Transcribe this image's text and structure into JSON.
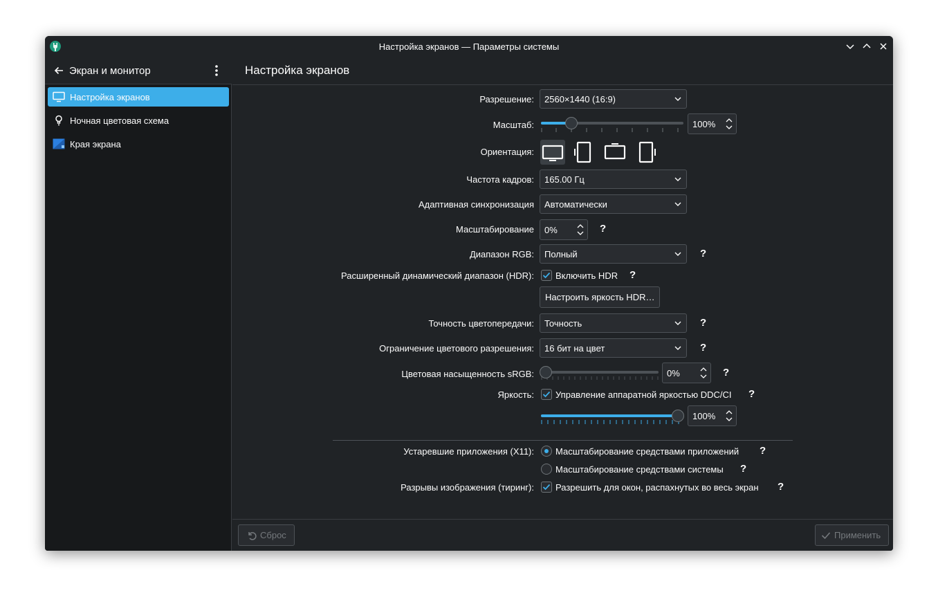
{
  "window": {
    "title": "Настройка экранов — Параметры системы"
  },
  "sidebar": {
    "header": "Экран и монитор",
    "items": [
      {
        "label": "Настройка экранов",
        "icon": "monitor-icon",
        "active": true
      },
      {
        "label": "Ночная цветовая схема",
        "icon": "bulb-icon",
        "active": false
      },
      {
        "label": "Края экрана",
        "icon": "screen-edges-icon",
        "active": false
      }
    ]
  },
  "page": {
    "title": "Настройка экранов"
  },
  "form": {
    "resolution": {
      "label": "Разрешение:",
      "value": "2560×1440 (16:9)"
    },
    "scale": {
      "label": "Масштаб:",
      "value": "100%",
      "slider_fraction": 0.2
    },
    "orientation": {
      "label": "Ориентация:"
    },
    "refresh": {
      "label": "Частота кадров:",
      "value": "165.00 Гц"
    },
    "adaptive_sync": {
      "label": "Адаптивная синхронизация",
      "value": "Автоматически"
    },
    "overscan": {
      "label": "Масштабирование",
      "value": "0%"
    },
    "rgb_range": {
      "label": "Диапазон RGB:",
      "value": "Полный"
    },
    "hdr": {
      "label": "Расширенный динамический диапазон (HDR):",
      "checkbox": "Включить HDR",
      "checked": true,
      "button": "Настроить яркость HDR…"
    },
    "color_accuracy": {
      "label": "Точность цветопередачи:",
      "value": "Точность"
    },
    "color_depth": {
      "label": "Ограничение цветового разрешения:",
      "value": "16 бит на цвет"
    },
    "srgb": {
      "label": "Цветовая насыщенность sRGB:",
      "value": "0%",
      "slider_fraction": 0.0
    },
    "brightness": {
      "label": "Яркость:",
      "checkbox": "Управление аппаратной яркостью DDC/CI",
      "checked": true,
      "value": "100%",
      "slider_fraction": 1.0
    },
    "legacy": {
      "label": "Устаревшие приложения (X11):",
      "option1": "Масштабирование средствами приложений",
      "option2": "Масштабирование средствами системы",
      "selected": 1
    },
    "tearing": {
      "label": "Разрывы изображения (тиринг):",
      "checkbox": "Разрешить для окон, распахнутых во весь экран",
      "checked": true
    },
    "help_mark": "?"
  },
  "footer": {
    "reset": "Сброс",
    "apply": "Применить"
  },
  "colors": {
    "accent": "#3daee9",
    "bg": "#202326",
    "sidebar_bg": "#17191b"
  }
}
